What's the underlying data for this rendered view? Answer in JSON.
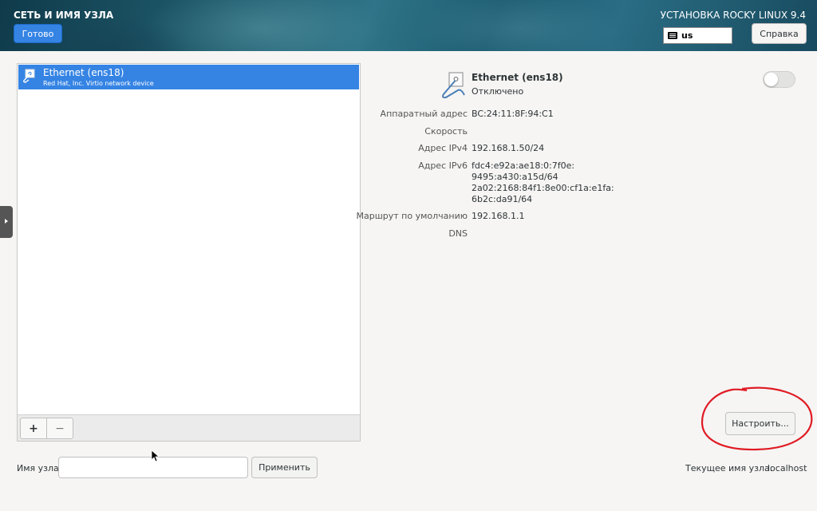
{
  "header": {
    "page_title": "СЕТЬ И ИМЯ УЗЛА",
    "done_label": "Готово",
    "install_title": "УСТАНОВКА ROCKY LINUX 9.4",
    "keyboard_layout": "us",
    "help_label": "Справка"
  },
  "device_list": {
    "items": [
      {
        "name": "Ethernet (ens18)",
        "description": "Red Hat, Inc. Virtio network device",
        "selected": true
      }
    ],
    "add_label": "+",
    "remove_label": "−"
  },
  "device_detail": {
    "name": "Ethernet (ens18)",
    "status": "Отключено",
    "enabled": false,
    "fields": [
      {
        "label": "Аппаратный адрес",
        "value": "BC:24:11:8F:94:C1"
      },
      {
        "label": "Скорость",
        "value": ""
      },
      {
        "label": "Адрес IPv4",
        "value": "192.168.1.50/24"
      },
      {
        "label": "Адрес IPv6",
        "value": "fdc4:e92a:ae18:0:7f0e:\n9495:a430:a15d/64\n2a02:2168:84f1:8e00:cf1a:e1fa:\n6b2c:da91/64"
      },
      {
        "label": "Маршрут по умолчанию",
        "value": "192.168.1.1"
      },
      {
        "label": "DNS",
        "value": ""
      }
    ],
    "configure_label": "Настроить..."
  },
  "hostname": {
    "label": "Имя узла:",
    "value": "",
    "apply_label": "Применить",
    "current_label": "Текущее имя узла:",
    "current_value": "localhost"
  },
  "colors": {
    "accent": "#3584e4",
    "annotation": "#e01b24"
  }
}
